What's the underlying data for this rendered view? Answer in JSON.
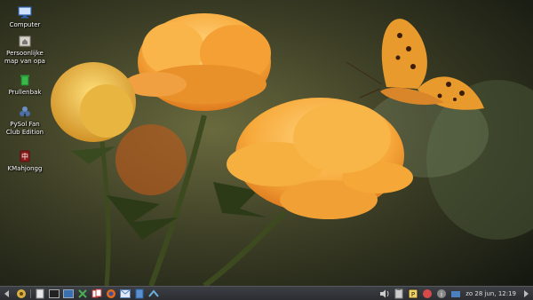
{
  "desktop": {
    "icons": [
      {
        "label": "Computer"
      },
      {
        "label": "Persoonlijke\nmap van opa"
      },
      {
        "label": "Prullenbak"
      },
      {
        "label": "PySol Fan\nClub Edition"
      },
      {
        "label": "KMahjongg"
      }
    ]
  },
  "taskbar": {
    "clock": "zo 28 jun, 12:19",
    "launchers": [
      "start-menu-icon",
      "file-manager-icon",
      "terminal-icon",
      "desktop-show-icon",
      "chess-icon",
      "solitaire-icon",
      "firefox-icon",
      "mail-icon",
      "documents-icon",
      "network-icon"
    ]
  },
  "colors": {
    "taskbar": "#2b2d31",
    "petal": "#f7a93a",
    "butterfly": "#e89a2c"
  }
}
